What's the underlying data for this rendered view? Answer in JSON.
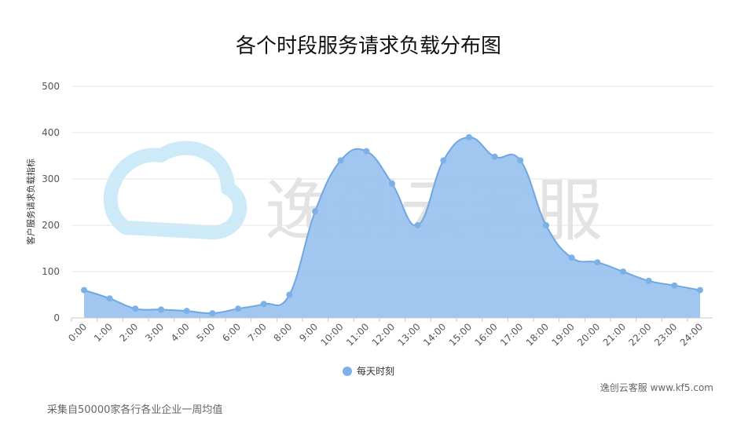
{
  "watermark": {
    "text": "逸创云客服"
  },
  "footer": {
    "source": "逸创云客服 www.kf5.com",
    "note": "采集自50000家各行各业企业一周均值"
  },
  "colors": {
    "area_fill": "#9cc3ee",
    "line": "#6fa7e2",
    "point": "#7cb1e8",
    "watermark_icon": "#cdeaf8"
  },
  "chart_data": {
    "type": "area",
    "title": "各个时段服务请求负载分布图",
    "xlabel": "",
    "ylabel": "客户服务请求负载指标",
    "ylim": [
      0,
      500
    ],
    "yticks": [
      0,
      100,
      200,
      300,
      400,
      500
    ],
    "grid": true,
    "legend_position": "bottom-center",
    "categories": [
      "0:00",
      "1:00",
      "2:00",
      "3:00",
      "4:00",
      "5:00",
      "6:00",
      "7:00",
      "8:00",
      "9:00",
      "10:00",
      "11:00",
      "12:00",
      "13:00",
      "14:00",
      "15:00",
      "16:00",
      "17:00",
      "18:00",
      "19:00",
      "20:00",
      "21:00",
      "22:00",
      "23:00",
      "24:00"
    ],
    "series": [
      {
        "name": "每天时刻",
        "values": [
          60,
          42,
          20,
          18,
          15,
          10,
          20,
          30,
          50,
          230,
          340,
          360,
          290,
          200,
          340,
          390,
          348,
          340,
          200,
          130,
          120,
          100,
          80,
          70,
          60
        ]
      }
    ]
  }
}
